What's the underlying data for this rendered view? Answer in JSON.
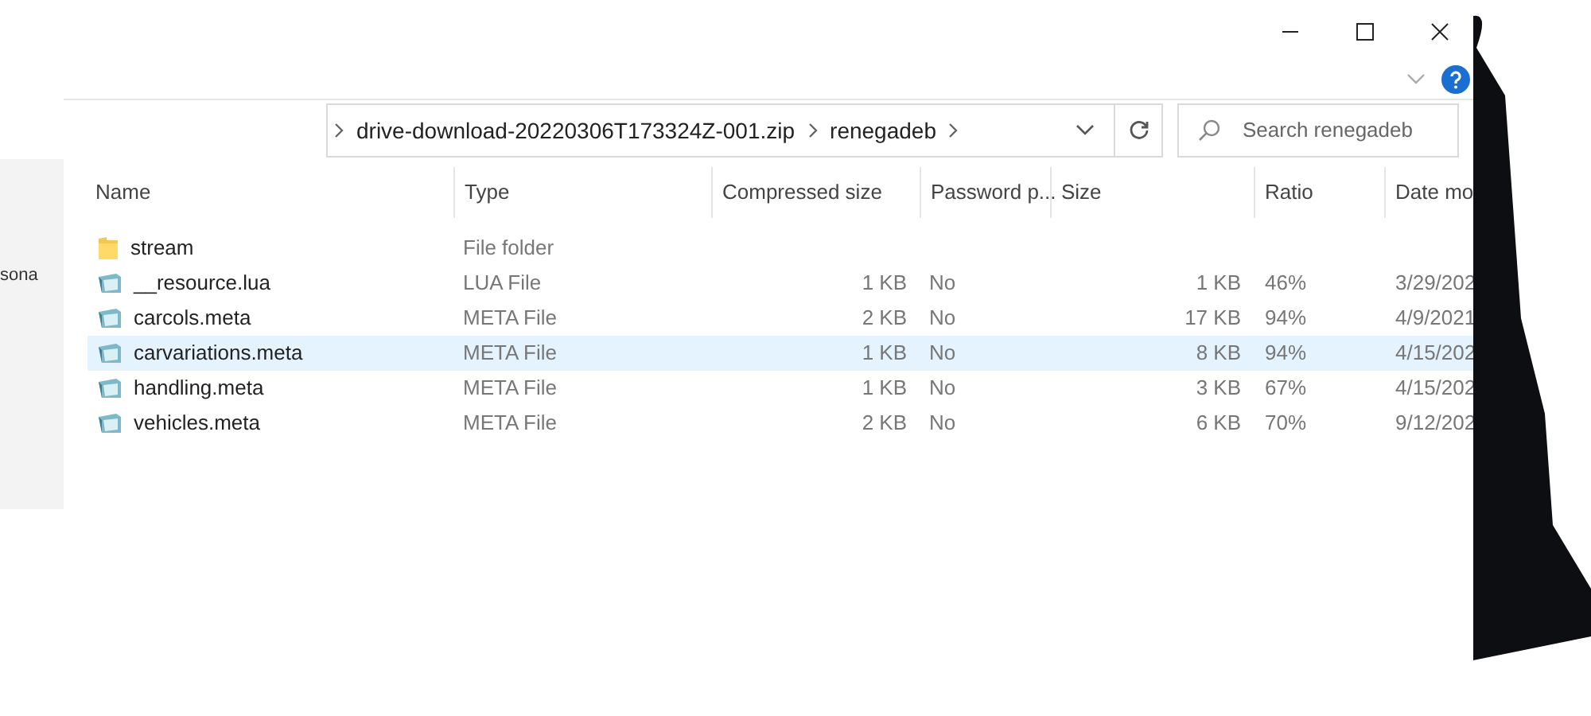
{
  "side_fragment": "sona",
  "address_bar": {
    "segments": [
      "drive-download-20220306T173324Z-001.zip",
      "renegadeb"
    ]
  },
  "search": {
    "placeholder": "Search renegadeb"
  },
  "table": {
    "columns": [
      "Name",
      "Type",
      "Compressed size",
      "Password p...",
      "Size",
      "Ratio",
      "Date mo"
    ],
    "rows": [
      {
        "kind": "folder",
        "name": "stream",
        "type": "File folder",
        "selected": false
      },
      {
        "kind": "file",
        "name": "__resource.lua",
        "type": "LUA File",
        "compressed": "1 KB",
        "password": "No",
        "size": "1 KB",
        "ratio": "46%",
        "date": "3/29/202",
        "selected": false
      },
      {
        "kind": "file",
        "name": "carcols.meta",
        "type": "META File",
        "compressed": "2 KB",
        "password": "No",
        "size": "17 KB",
        "ratio": "94%",
        "date": "4/9/2021",
        "selected": false
      },
      {
        "kind": "file",
        "name": "carvariations.meta",
        "type": "META File",
        "compressed": "1 KB",
        "password": "No",
        "size": "8 KB",
        "ratio": "94%",
        "date": "4/15/202",
        "selected": true
      },
      {
        "kind": "file",
        "name": "handling.meta",
        "type": "META File",
        "compressed": "1 KB",
        "password": "No",
        "size": "3 KB",
        "ratio": "67%",
        "date": "4/15/202",
        "selected": false
      },
      {
        "kind": "file",
        "name": "vehicles.meta",
        "type": "META File",
        "compressed": "2 KB",
        "password": "No",
        "size": "6 KB",
        "ratio": "70%",
        "date": "9/12/202",
        "selected": false
      }
    ]
  }
}
